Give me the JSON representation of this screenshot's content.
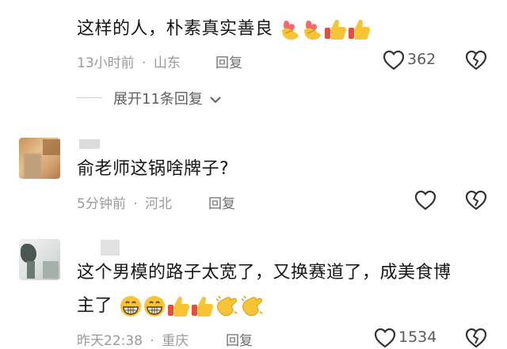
{
  "comments": [
    {
      "text": "这样的人，朴素真实善良",
      "emojis": [
        "finger-heart",
        "finger-heart",
        "thumbs-up",
        "thumbs-up"
      ],
      "time": "13小时前",
      "sep": "·",
      "location": "山东",
      "reply_label": "回复",
      "likes": "362",
      "expand_label": "展开11条回复"
    },
    {
      "text": "俞老师这锅啥牌子?",
      "time": "5分钟前",
      "sep": "·",
      "location": "河北",
      "reply_label": "回复"
    },
    {
      "text_line1": "这个男模的路子太宽了，又换赛道了，成美食博",
      "text_line2": "主了",
      "emojis": [
        "grinning",
        "grinning",
        "thumbs-up",
        "thumbs-up",
        "clapping",
        "clapping"
      ],
      "time": "昨天22:38",
      "sep": "·",
      "location": "重庆",
      "reply_label": "回复",
      "likes": "1534"
    }
  ]
}
